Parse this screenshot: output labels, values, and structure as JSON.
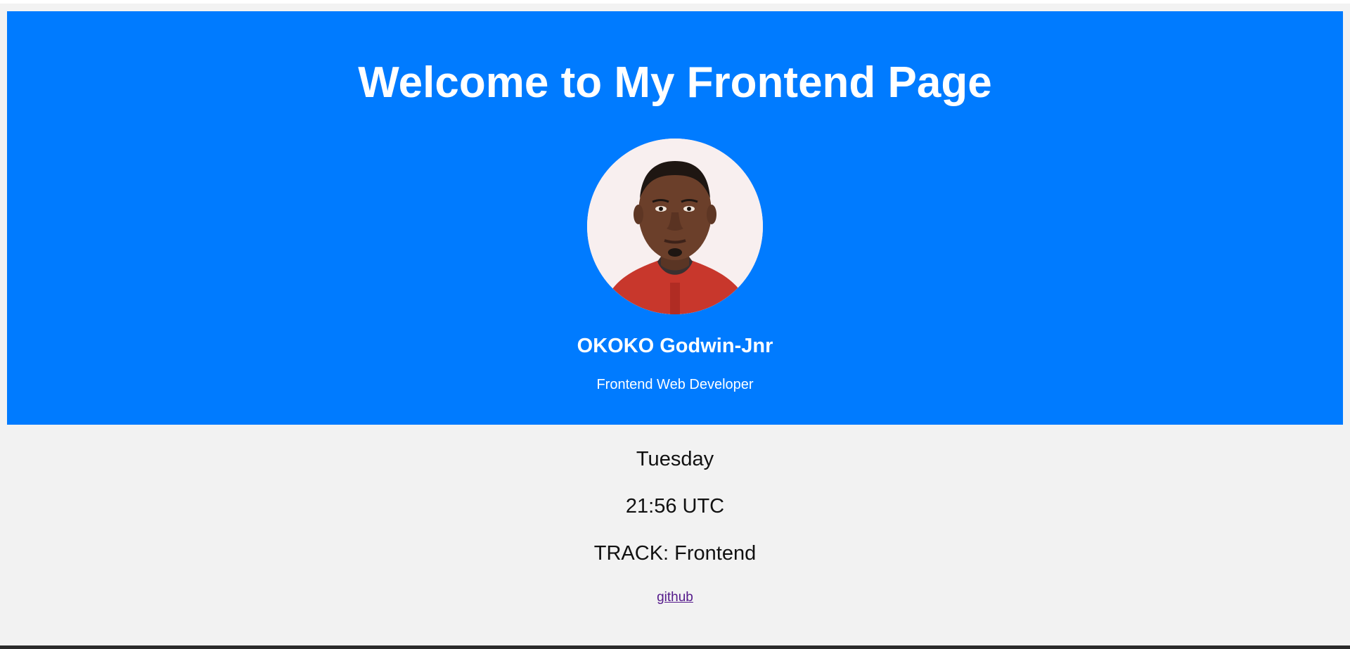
{
  "hero": {
    "title": "Welcome to My Frontend Page",
    "name": "OKOKO Godwin-Jnr",
    "role": "Frontend Web Developer",
    "background_color": "#007bff"
  },
  "info": {
    "day": "Tuesday",
    "time": "21:56 UTC",
    "track": "TRACK: Frontend",
    "link_label": "github"
  }
}
